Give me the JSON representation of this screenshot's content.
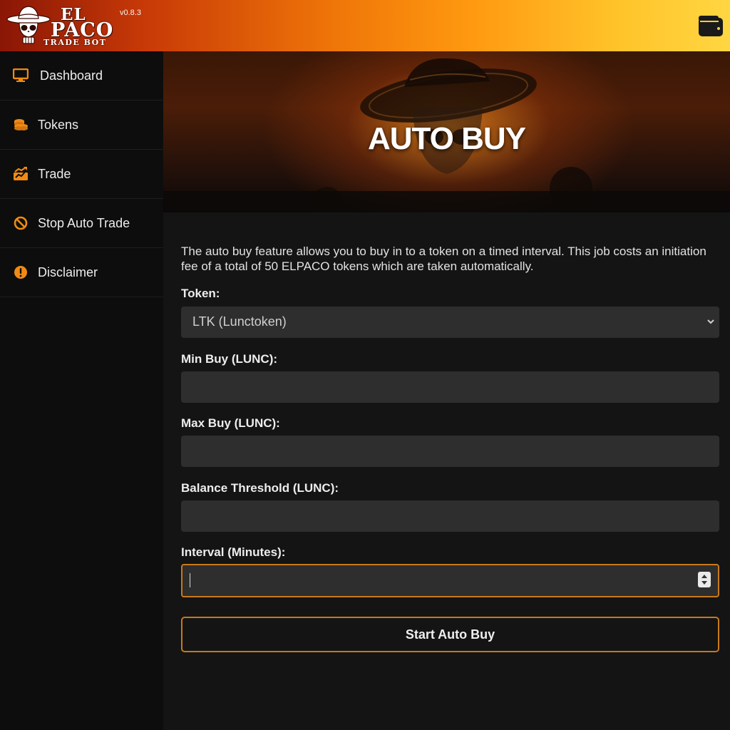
{
  "header": {
    "logo_line1": "EL",
    "logo_line2": "PACO",
    "logo_sub": "TRADE BOT",
    "version": "v0.8.3",
    "wallet_icon": "wallet-icon"
  },
  "sidebar": {
    "items": [
      {
        "label": "Dashboard",
        "icon": "monitor-icon"
      },
      {
        "label": "Tokens",
        "icon": "coins-icon"
      },
      {
        "label": "Trade",
        "icon": "chart-icon"
      },
      {
        "label": "Stop Auto Trade",
        "icon": "ban-icon"
      },
      {
        "label": "Disclaimer",
        "icon": "exclamation-icon"
      }
    ]
  },
  "main": {
    "hero_title": "AUTO BUY",
    "intro": "The auto buy feature allows you to buy in to a token on a timed interval. This job costs an initiation fee of a total of 50 ELPACO tokens which are taken automatically.",
    "token_label": "Token:",
    "token_selected": "LTK (Lunctoken)",
    "min_buy_label": "Min Buy (LUNC):",
    "min_buy_value": "",
    "max_buy_label": "Max Buy (LUNC):",
    "max_buy_value": "",
    "balance_label": "Balance Threshold (LUNC):",
    "balance_value": "",
    "interval_label": "Interval (Minutes):",
    "interval_value": "",
    "start_button": "Start Auto Buy"
  },
  "colors": {
    "accent": "#ff9a10",
    "border_accent": "#c8791a",
    "icon_orange": "#f08a12",
    "panel": "#2e2e2e"
  }
}
